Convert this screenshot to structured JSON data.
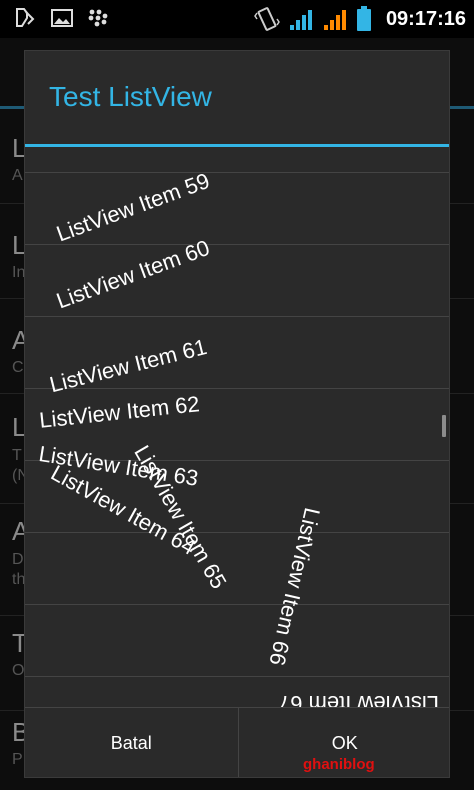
{
  "status_bar": {
    "time": "09:17:16",
    "icons": [
      "usb-debug-icon",
      "image-notification-icon",
      "blackberry-icon",
      "vibrate-icon",
      "signal-icon",
      "signal-icon",
      "battery-icon"
    ]
  },
  "background": {
    "rows": [
      {
        "title": "L",
        "sub": "A"
      },
      {
        "title": "L",
        "sub": "In"
      },
      {
        "title": "A",
        "sub": "C"
      },
      {
        "title": "L",
        "sub": "T (N"
      },
      {
        "title": "A",
        "sub": "D th"
      },
      {
        "title": "T",
        "sub": "O"
      },
      {
        "title": "B",
        "sub": "P"
      }
    ]
  },
  "dialog": {
    "title": "Test ListView",
    "items": [
      "ListView Item 59",
      "ListView Item 60",
      "ListView Item 61",
      "ListView Item 62",
      "ListView Item 63",
      "ListView Item 64",
      "ListView Item 65",
      "ListView Item 66",
      "ListView Item 67"
    ],
    "buttons": {
      "cancel": "Batal",
      "ok": "OK"
    }
  },
  "watermark": "ghaniblog",
  "colors": {
    "accent": "#33b5e5",
    "dialog_bg": "#2a2a2a",
    "watermark": "#e01010"
  }
}
